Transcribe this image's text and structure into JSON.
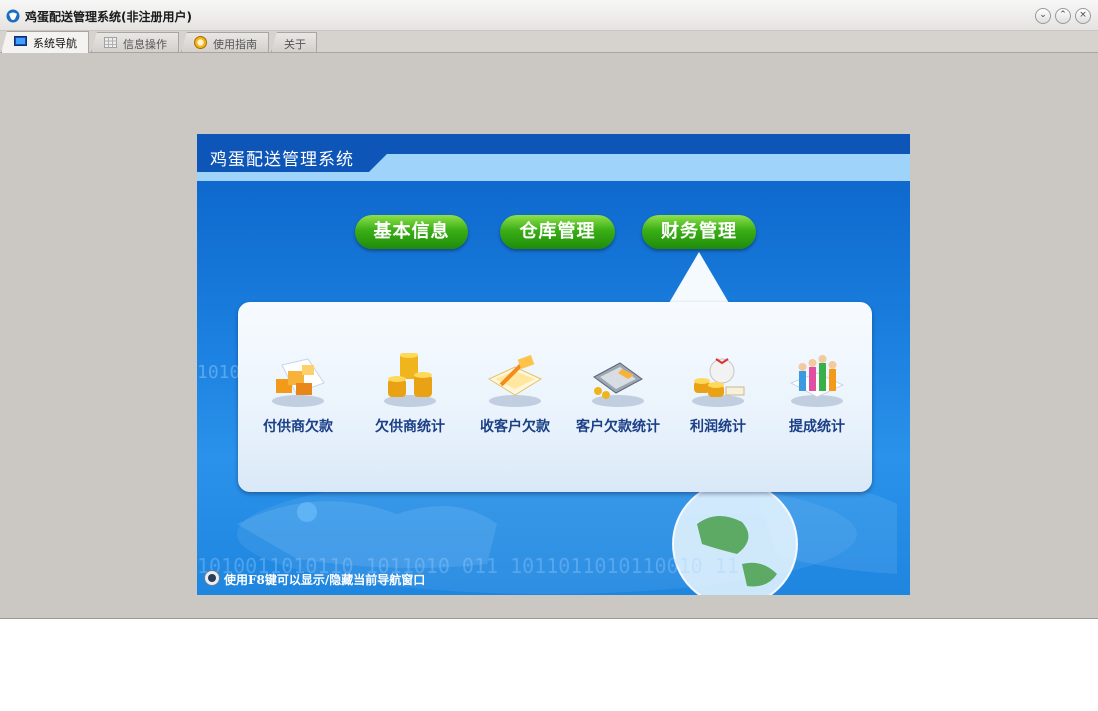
{
  "window": {
    "title": "鸡蛋配送管理系统(非注册用户)",
    "controls": [
      "minimize",
      "maximize",
      "close"
    ]
  },
  "tabs": [
    {
      "label": "系统导航",
      "icon": "monitor-icon",
      "active": true
    },
    {
      "label": "信息操作",
      "icon": "grid-icon",
      "active": false
    },
    {
      "label": "使用指南",
      "icon": "help-icon",
      "active": false
    },
    {
      "label": "关于",
      "icon": "",
      "active": false
    }
  ],
  "panel": {
    "system_title": "鸡蛋配送管理系统",
    "menu_buttons": [
      {
        "label": "基本信息",
        "selected": false
      },
      {
        "label": "仓库管理",
        "selected": false
      },
      {
        "label": "财务管理",
        "selected": true
      }
    ],
    "finance_items": [
      {
        "label": "付供商欠款",
        "icon": "boxes-icon"
      },
      {
        "label": "欠供商统计",
        "icon": "coins-stack-icon"
      },
      {
        "label": "收客户欠款",
        "icon": "documents-pen-icon"
      },
      {
        "label": "客户欠款统计",
        "icon": "calculator-icon"
      },
      {
        "label": "利润统计",
        "icon": "money-bag-icon"
      },
      {
        "label": "提成统计",
        "icon": "people-chart-icon"
      }
    ],
    "background_binary": "1010011010110   1011010  011  1011011010110010    11",
    "side_binary": "1010",
    "hint": "使用F8键可以显示/隐藏当前导航窗口"
  },
  "colors": {
    "window_bg": "#cbc7c3",
    "panel_blue": "#1b80e0",
    "button_green": "#3aae16",
    "label_navy": "#1a3f86"
  }
}
